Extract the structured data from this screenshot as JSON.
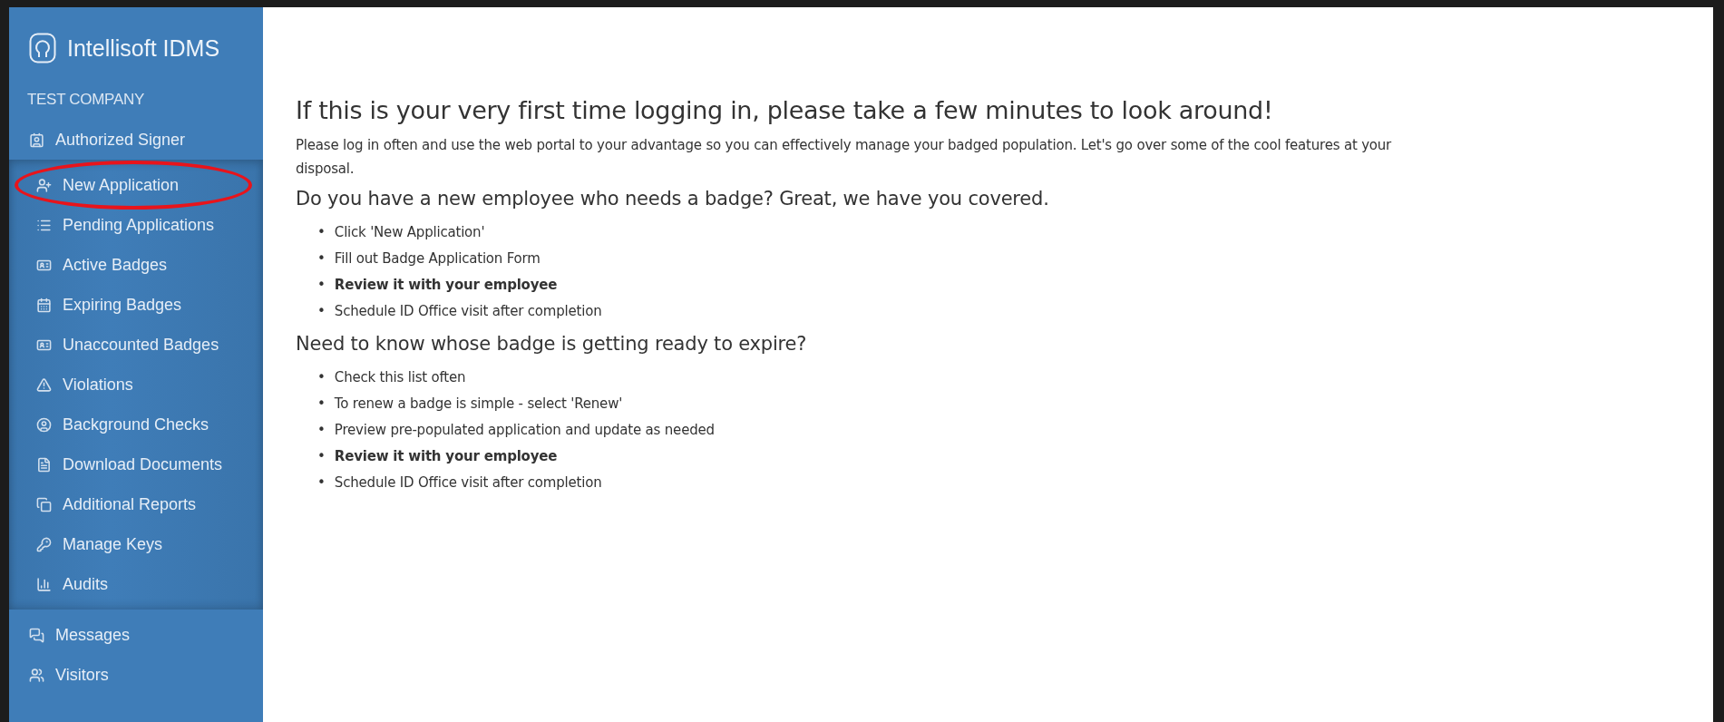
{
  "brand": {
    "name": "Intellisoft IDMS"
  },
  "company": "TEST COMPANY",
  "sidebar": {
    "items": [
      {
        "label": "Authorized Signer",
        "children": [
          {
            "label": "New Application",
            "circled": true
          },
          {
            "label": "Pending Applications",
            "circled": false
          },
          {
            "label": "Active Badges",
            "circled": false
          },
          {
            "label": "Expiring Badges",
            "circled": false
          },
          {
            "label": "Unaccounted Badges",
            "circled": false
          },
          {
            "label": "Violations",
            "circled": false
          },
          {
            "label": "Background Checks",
            "circled": false
          },
          {
            "label": "Download Documents",
            "circled": false
          },
          {
            "label": "Additional Reports",
            "circled": false
          },
          {
            "label": "Manage Keys",
            "circled": false
          },
          {
            "label": "Audits",
            "circled": false
          }
        ]
      },
      {
        "label": "Messages"
      },
      {
        "label": "Visitors"
      }
    ]
  },
  "content": {
    "title": "If this is your very first time logging in, please take a few minutes to look around!",
    "intro": "Please log in often and use the web portal to your advantage so you can effectively manage your badged population. Let's go over some of the cool features at your disposal.",
    "sections": [
      {
        "heading": "Do you have a new employee who needs a badge? Great, we have you covered.",
        "bullets": [
          {
            "marker": "•",
            "text": "Click 'New Application'",
            "bold": false
          },
          {
            "marker": "•",
            "text": "Fill out Badge Application Form",
            "bold": false
          },
          {
            "marker": "•",
            "text": "Review it with your employee",
            "bold": true
          },
          {
            "marker": "•",
            "text": "Schedule ID Office visit after completion",
            "bold": false
          }
        ]
      },
      {
        "heading": "Need to know whose badge is getting ready to expire?",
        "bullets": [
          {
            "marker": "•",
            "text": "Check this list often",
            "bold": false
          },
          {
            "marker": "•",
            "text": "To renew a badge is simple - select 'Renew'",
            "bold": false
          },
          {
            "marker": "•",
            "text": "Preview pre-populated application and update as needed",
            "bold": false
          },
          {
            "marker": "•",
            "text": "Review it with your employee",
            "bold": true
          },
          {
            "marker": "•",
            "text": "Schedule ID Office visit after completion",
            "bold": false
          }
        ]
      }
    ]
  }
}
